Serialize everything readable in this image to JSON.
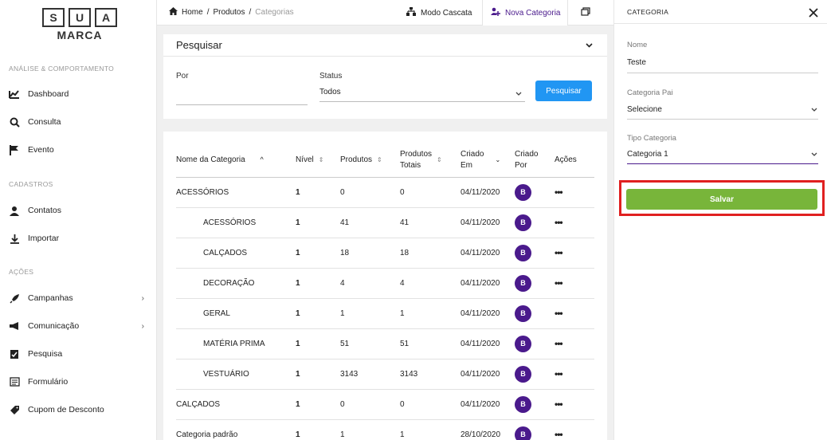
{
  "logo": {
    "letters": [
      "S",
      "U",
      "A"
    ],
    "text": "MARCA"
  },
  "sidebar": {
    "sections": [
      "ANÁLISE & COMPORTAMENTO",
      "CADASTROS",
      "AÇÕES"
    ],
    "items": [
      {
        "label": "Dashboard",
        "icon": "chart-icon"
      },
      {
        "label": "Consulta",
        "icon": "search-icon"
      },
      {
        "label": "Evento",
        "icon": "flag-icon"
      },
      {
        "label": "Contatos",
        "icon": "contacts-icon"
      },
      {
        "label": "Importar",
        "icon": "download-icon"
      },
      {
        "label": "Campanhas",
        "icon": "rocket-icon"
      },
      {
        "label": "Comunicação",
        "icon": "megaphone-icon"
      },
      {
        "label": "Pesquisa",
        "icon": "survey-icon"
      },
      {
        "label": "Formulário",
        "icon": "form-icon"
      },
      {
        "label": "Cupom de Desconto",
        "icon": "tag-icon"
      }
    ]
  },
  "breadcrumb": {
    "home": "Home",
    "sep": "/",
    "produtos": "Produtos",
    "categorias": "Categorias"
  },
  "toolbar": {
    "modo_cascata": "Modo Cascata",
    "nova_categoria": "Nova Categoria"
  },
  "search": {
    "title": "Pesquisar",
    "por_label": "Por",
    "por_value": "",
    "status_label": "Status",
    "status_value": "Todos",
    "button": "Pesquisar"
  },
  "table": {
    "headers": {
      "nome": "Nome da Categoria",
      "nivel": "Nível",
      "produtos": "Produtos",
      "produtos_totais_1": "Produtos",
      "produtos_totais_2": "Totais",
      "criado_em_1": "Criado",
      "criado_em_2": "Em",
      "criado_por_1": "Criado",
      "criado_por_2": "Por",
      "acoes": "Ações"
    },
    "rows": [
      {
        "nome": "ACESSÓRIOS",
        "nivel": "1",
        "produtos": "0",
        "totais": "0",
        "criado_em": "04/11/2020",
        "criado_por": "B",
        "acoes": "•••"
      },
      {
        "nome": "ACESSÓRIOS",
        "nivel": "1",
        "produtos": "41",
        "totais": "41",
        "criado_em": "04/11/2020",
        "criado_por": "B",
        "acoes": "•••"
      },
      {
        "nome": "CALÇADOS",
        "nivel": "1",
        "produtos": "18",
        "totais": "18",
        "criado_em": "04/11/2020",
        "criado_por": "B",
        "acoes": "•••"
      },
      {
        "nome": "DECORAÇÃO",
        "nivel": "1",
        "produtos": "4",
        "totais": "4",
        "criado_em": "04/11/2020",
        "criado_por": "B",
        "acoes": "•••"
      },
      {
        "nome": "GERAL",
        "nivel": "1",
        "produtos": "1",
        "totais": "1",
        "criado_em": "04/11/2020",
        "criado_por": "B",
        "acoes": "•••"
      },
      {
        "nome": "MATÉRIA PRIMA",
        "nivel": "1",
        "produtos": "51",
        "totais": "51",
        "criado_em": "04/11/2020",
        "criado_por": "B",
        "acoes": "•••"
      },
      {
        "nome": "VESTUÁRIO",
        "nivel": "1",
        "produtos": "3143",
        "totais": "3143",
        "criado_em": "04/11/2020",
        "criado_por": "B",
        "acoes": "•••"
      },
      {
        "nome": "CALÇADOS",
        "nivel": "1",
        "produtos": "0",
        "totais": "0",
        "criado_em": "04/11/2020",
        "criado_por": "B",
        "acoes": "•••"
      },
      {
        "nome": "Categoria padrão",
        "nivel": "1",
        "produtos": "1",
        "totais": "1",
        "criado_em": "28/10/2020",
        "criado_por": "B",
        "acoes": "•••"
      }
    ]
  },
  "panel": {
    "title": "CATEGORIA",
    "nome_label": "Nome",
    "nome_value": "Teste",
    "pai_label": "Categoria Pai",
    "pai_value": "Selecione",
    "tipo_label": "Tipo Categoria",
    "tipo_value": "Categoria 1",
    "save": "Salvar"
  },
  "colors": {
    "accent": "#4a1a8c",
    "primary": "#2196f3",
    "success": "#78b53a",
    "highlight": "#e02020"
  }
}
